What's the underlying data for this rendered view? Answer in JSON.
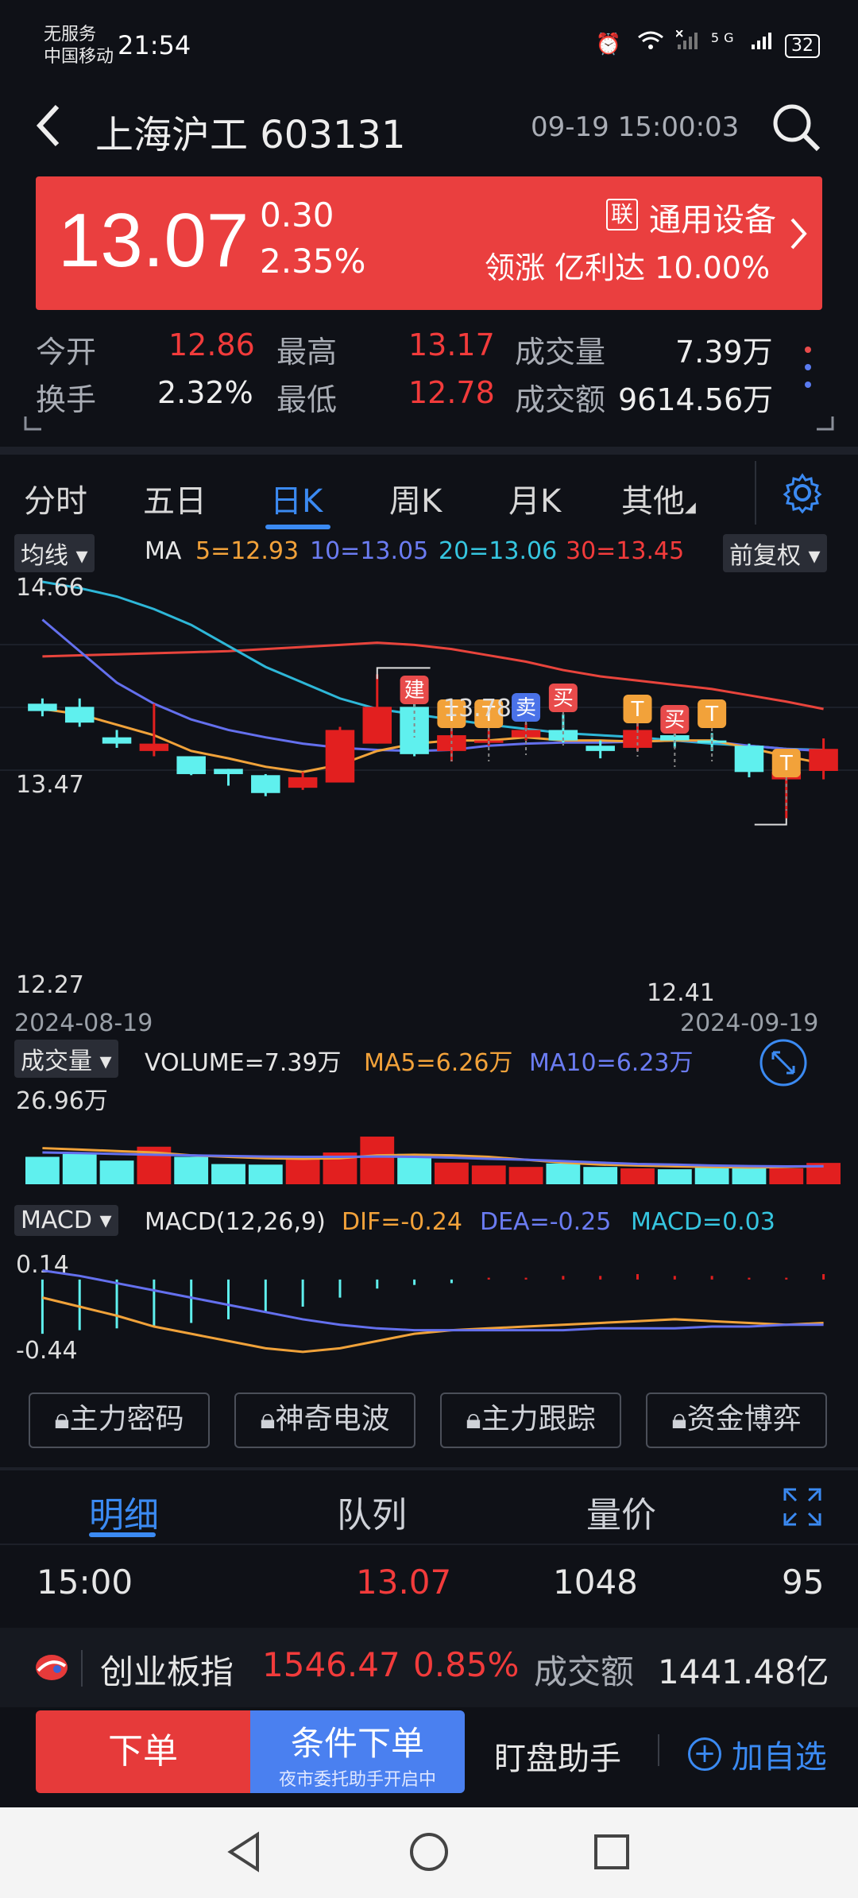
{
  "status_bar": {
    "carrier_line1": "无服务",
    "carrier_line2": "中国移动",
    "time": "21:54",
    "signal_text": "5G",
    "battery": "32"
  },
  "header": {
    "title": "上海沪工 603131",
    "datetime": "09-19 15:00:03"
  },
  "price": {
    "last": "13.07",
    "change": "0.30",
    "change_pct": "2.35%",
    "sector_badge": "联",
    "sector": "通用设备",
    "leader": "领涨 亿利达 10.00%"
  },
  "quote": {
    "open_label": "今开",
    "open": "12.86",
    "high_label": "最高",
    "high": "13.17",
    "volume_label": "成交量",
    "volume": "7.39万",
    "turnover_label": "换手",
    "turnover": "2.32%",
    "low_label": "最低",
    "low": "12.78",
    "amount_label": "成交额",
    "amount": "9614.56万"
  },
  "tabs": [
    "分时",
    "五日",
    "日K",
    "周K",
    "月K",
    "其他"
  ],
  "chart": {
    "ma_chip": "均线",
    "ma_label": "MA",
    "ma5": "5=12.93",
    "ma10": "10=13.05",
    "ma20": "20=13.06",
    "ma30": "30=13.45",
    "adjust_chip": "前复权",
    "y_high": "14.66",
    "y_mid": "13.47",
    "y_low": "12.27",
    "peak_label": "13.78",
    "trough_label": "12.41",
    "date_start": "2024-08-19",
    "date_end": "2024-09-19",
    "vol_chip": "成交量",
    "vol_label": "VOLUME=7.39万",
    "vol_ma5": "MA5=6.26万",
    "vol_ma10": "MA10=6.23万",
    "vol_top": "26.96万",
    "macd_chip": "MACD",
    "macd_label": "MACD(12,26,9)",
    "dif": "DIF=-0.24",
    "dea": "DEA=-0.25",
    "macd": "MACD=0.03",
    "macd_top": "0.14",
    "macd_bottom": "-0.44",
    "markers": {
      "jian": "建",
      "mai_sell": "卖",
      "mai_buy": "买",
      "t": "T"
    }
  },
  "chart_data": {
    "type": "candlestick",
    "dates_range": [
      "2024-08-19",
      "2024-09-19"
    ],
    "ylim": [
      12.27,
      14.66
    ],
    "candles": [
      {
        "o": 13.5,
        "c": 13.43,
        "h": 13.55,
        "l": 13.38
      },
      {
        "o": 13.47,
        "c": 13.32,
        "h": 13.55,
        "l": 13.28
      },
      {
        "o": 13.18,
        "c": 13.12,
        "h": 13.25,
        "l": 13.08
      },
      {
        "o": 13.05,
        "c": 13.12,
        "h": 13.5,
        "l": 13.0
      },
      {
        "o": 13.0,
        "c": 12.83,
        "h": 13.0,
        "l": 12.82
      },
      {
        "o": 12.88,
        "c": 12.83,
        "h": 12.88,
        "l": 12.72
      },
      {
        "o": 12.82,
        "c": 12.65,
        "h": 12.83,
        "l": 12.62
      },
      {
        "o": 12.7,
        "c": 12.8,
        "h": 12.85,
        "l": 12.68
      },
      {
        "o": 12.75,
        "c": 13.25,
        "h": 13.28,
        "l": 12.75
      },
      {
        "o": 13.12,
        "c": 13.47,
        "h": 13.78,
        "l": 13.12
      },
      {
        "o": 13.47,
        "c": 13.02,
        "h": 13.58,
        "l": 13.0
      },
      {
        "o": 13.05,
        "c": 13.2,
        "h": 13.3,
        "l": 12.95
      },
      {
        "o": 13.15,
        "c": 13.15,
        "h": 13.25,
        "l": 13.1
      },
      {
        "o": 13.18,
        "c": 13.25,
        "h": 13.32,
        "l": 13.15
      },
      {
        "o": 13.25,
        "c": 13.15,
        "h": 13.4,
        "l": 13.13
      },
      {
        "o": 13.1,
        "c": 13.05,
        "h": 13.15,
        "l": 12.98
      },
      {
        "o": 13.08,
        "c": 13.25,
        "h": 13.32,
        "l": 13.05
      },
      {
        "o": 13.2,
        "c": 13.15,
        "h": 13.25,
        "l": 13.08
      },
      {
        "o": 13.15,
        "c": 13.13,
        "h": 13.22,
        "l": 13.05
      },
      {
        "o": 13.1,
        "c": 12.85,
        "h": 13.12,
        "l": 12.8
      },
      {
        "o": 12.78,
        "c": 12.85,
        "h": 12.95,
        "l": 12.41
      },
      {
        "o": 12.86,
        "c": 13.07,
        "h": 13.17,
        "l": 12.78
      }
    ],
    "ma5": [
      13.45,
      13.4,
      13.3,
      13.2,
      13.05,
      12.98,
      12.9,
      12.85,
      12.92,
      13.05,
      13.12,
      13.15,
      13.15,
      13.18,
      13.15,
      13.15,
      13.14,
      13.15,
      13.15,
      13.08,
      13.0,
      12.93
    ],
    "ma10": [
      14.3,
      14.0,
      13.7,
      13.5,
      13.35,
      13.25,
      13.18,
      13.12,
      13.08,
      13.06,
      13.05,
      13.06,
      13.1,
      13.12,
      13.13,
      13.13,
      13.14,
      13.15,
      13.14,
      13.1,
      13.07,
      13.05
    ],
    "ma20": [
      14.66,
      14.6,
      14.52,
      14.4,
      14.25,
      14.05,
      13.85,
      13.7,
      13.55,
      13.45,
      13.4,
      13.35,
      13.3,
      13.26,
      13.22,
      13.2,
      13.18,
      13.15,
      13.12,
      13.1,
      13.07,
      13.06
    ],
    "ma30": [
      13.95,
      13.96,
      13.97,
      13.98,
      13.99,
      14.0,
      14.02,
      14.04,
      14.06,
      14.08,
      14.06,
      14.02,
      13.96,
      13.9,
      13.82,
      13.76,
      13.72,
      13.68,
      13.64,
      13.58,
      13.52,
      13.45
    ],
    "volume": {
      "ylim": [
        0,
        26.96
      ],
      "values": [
        9.5,
        10.5,
        8.2,
        13.0,
        9.5,
        7.0,
        6.8,
        8.5,
        11.0,
        16.5,
        10.5,
        7.5,
        6.5,
        6.0,
        7.2,
        6.0,
        5.5,
        5.2,
        6.0,
        5.8,
        5.5,
        7.39
      ],
      "ma5": [
        12.5,
        12.0,
        11.5,
        11.0,
        10.0,
        9.5,
        9.0,
        8.8,
        9.0,
        10.0,
        10.2,
        10.0,
        9.5,
        8.5,
        7.5,
        6.8,
        6.5,
        6.2,
        6.0,
        5.8,
        6.0,
        6.26
      ],
      "ma10": [
        11.0,
        10.8,
        10.5,
        10.2,
        10.0,
        9.8,
        9.6,
        9.5,
        9.5,
        9.6,
        9.5,
        9.2,
        8.8,
        8.5,
        8.0,
        7.5,
        7.0,
        6.8,
        6.5,
        6.3,
        6.2,
        6.23
      ]
    },
    "macd": {
      "ylim": [
        -0.44,
        0.14
      ],
      "hist": [
        -0.3,
        -0.28,
        -0.27,
        -0.26,
        -0.24,
        -0.22,
        -0.18,
        -0.15,
        -0.1,
        -0.05,
        -0.03,
        -0.02,
        0.01,
        0.01,
        0.02,
        0.02,
        0.03,
        0.02,
        0.02,
        0.01,
        0.01,
        0.03
      ],
      "dif": [
        -0.1,
        -0.15,
        -0.2,
        -0.26,
        -0.3,
        -0.34,
        -0.38,
        -0.4,
        -0.38,
        -0.34,
        -0.3,
        -0.28,
        -0.27,
        -0.26,
        -0.25,
        -0.24,
        -0.23,
        -0.22,
        -0.23,
        -0.24,
        -0.25,
        -0.24
      ],
      "dea": [
        0.05,
        0.02,
        -0.02,
        -0.06,
        -0.1,
        -0.14,
        -0.18,
        -0.22,
        -0.25,
        -0.27,
        -0.28,
        -0.28,
        -0.28,
        -0.28,
        -0.28,
        -0.27,
        -0.27,
        -0.27,
        -0.26,
        -0.26,
        -0.25,
        -0.25
      ]
    }
  },
  "lock_buttons": [
    "主力密码",
    "神奇电波",
    "主力跟踪",
    "资金博弈"
  ],
  "detail_tabs": [
    "明细",
    "队列",
    "量价"
  ],
  "detail_row": {
    "time": "15:00",
    "price": "13.07",
    "volume": "1048",
    "count": "95"
  },
  "index_bar": {
    "name": "创业板指",
    "value": "1546.47",
    "pct": "0.85%",
    "amount_label": "成交额",
    "amount": "1441.48亿"
  },
  "actions": {
    "order": "下单",
    "cond_order": "条件下单",
    "cond_sub": "夜市委托助手开启中",
    "assistant": "盯盘助手",
    "add_watch": "加自选"
  }
}
